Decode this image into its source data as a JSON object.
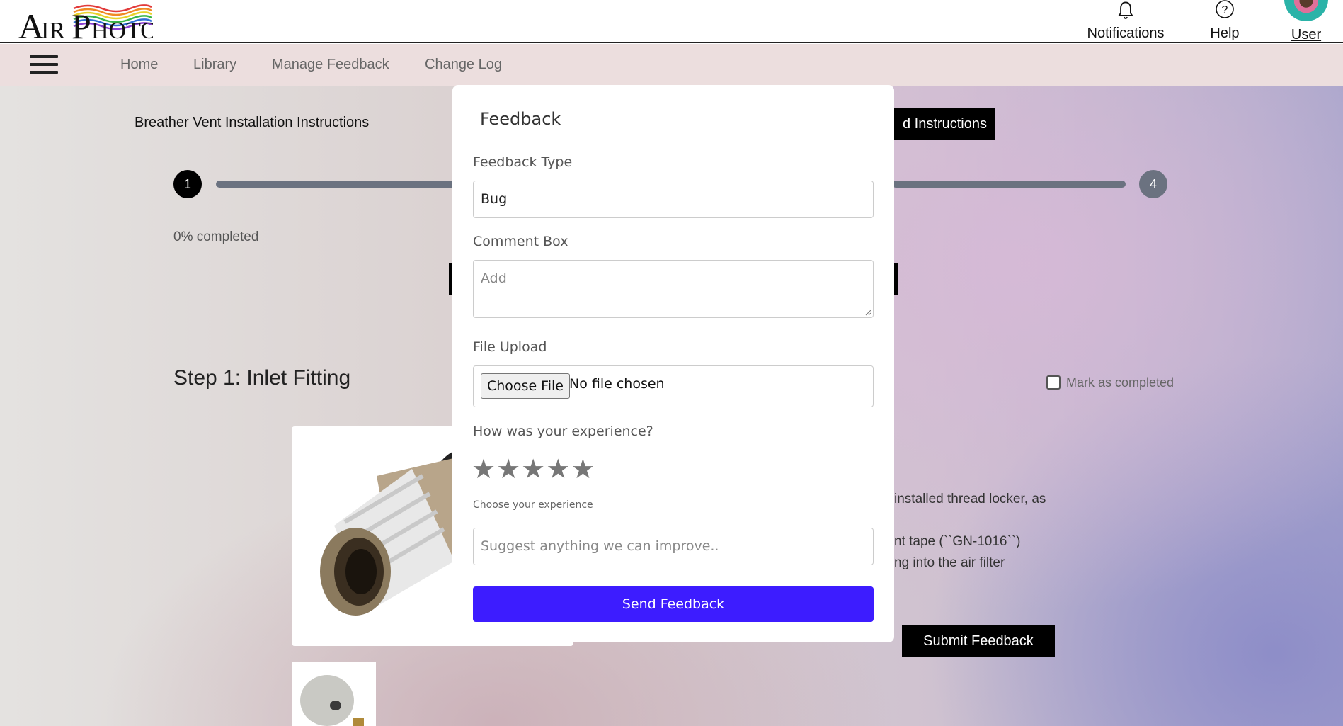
{
  "header": {
    "logo_text": "AirPhoton",
    "notifications_label": "Notifications",
    "help_label": "Help",
    "user_label": "User"
  },
  "nav": {
    "items": [
      "Home",
      "Library",
      "Manage Feedback",
      "Change Log"
    ]
  },
  "page": {
    "doc_title": "Breather Vent Installation Instructions",
    "instructions_button": "d Instructions",
    "step_start": "1",
    "step_end": "4",
    "progress_text": "0% completed",
    "progress_fraction": 0,
    "step_title": "Step 1: Inlet Fitting",
    "mark_completed": "Mark as completed",
    "body_lines": [
      "installed thread locker, as",
      "nt tape (``GN-1016``)",
      "ng into the air filter"
    ],
    "submit_button": "Submit Feedback"
  },
  "modal": {
    "title": "Feedback",
    "feedback_type_label": "Feedback Type",
    "feedback_type_value": "Bug",
    "comment_label": "Comment Box",
    "comment_placeholder": "Add",
    "file_label": "File Upload",
    "choose_file_button": "Choose File",
    "file_status": "No file chosen",
    "experience_label": "How was your experience?",
    "rating": {
      "value": 0,
      "max": 5
    },
    "experience_hint": "Choose your experience",
    "suggest_placeholder": "Suggest anything we can improve..",
    "send_button": "Send Feedback"
  },
  "colors": {
    "accent": "#3d1cff",
    "nav_bg": "#ecdede",
    "step_track": "#6b7280"
  }
}
